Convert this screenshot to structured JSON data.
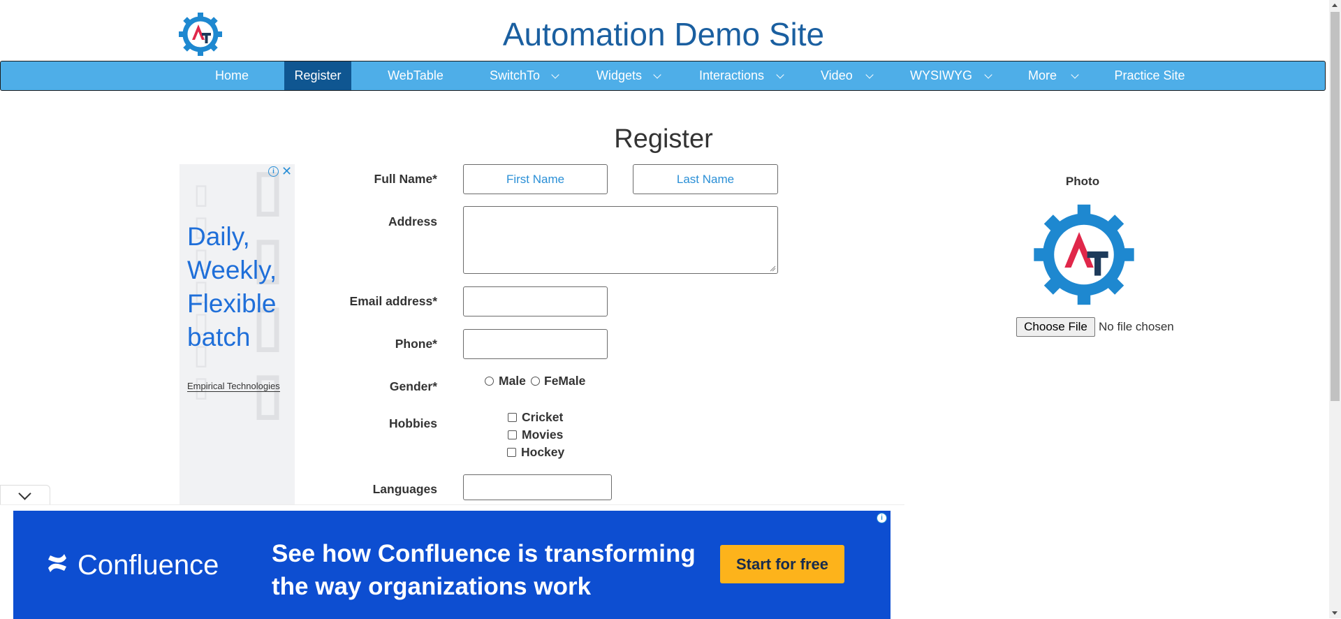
{
  "site": {
    "title": "Automation Demo Site"
  },
  "nav": {
    "items": [
      {
        "label": "Home"
      },
      {
        "label": "Register"
      },
      {
        "label": "WebTable"
      },
      {
        "label": "SwitchTo"
      },
      {
        "label": "Widgets"
      },
      {
        "label": "Interactions"
      },
      {
        "label": "Video"
      },
      {
        "label": "WYSIWYG"
      },
      {
        "label": "More"
      },
      {
        "label": "Practice Site"
      }
    ],
    "active": "Register"
  },
  "form": {
    "title": "Register",
    "full_name_label": "Full Name*",
    "first_name_placeholder": "First Name",
    "last_name_placeholder": "Last Name",
    "address_label": "Address",
    "email_label": "Email address*",
    "phone_label": "Phone*",
    "gender_label": "Gender*",
    "gender_options": [
      "Male",
      "FeMale"
    ],
    "hobbies_label": "Hobbies",
    "hobbies": [
      "Cricket",
      "Movies",
      "Hockey"
    ],
    "languages_label": "Languages"
  },
  "photo": {
    "label": "Photo",
    "button": "Choose File",
    "status": "No file chosen"
  },
  "side_ad": {
    "text": "Daily, Weekly, Flexible batch",
    "brand": "Empirical Technologies"
  },
  "bottom_ad": {
    "brand": "Confluence",
    "headline_line1": "See how Confluence is transforming",
    "headline_line2": "the way organizations work",
    "cta": "Start for free"
  },
  "colors": {
    "title_blue": "#1a5fa0",
    "nav_bg": "#4eaee8",
    "nav_active": "#0f5691",
    "ad_blue": "#0d4ed1",
    "cta_yellow": "#fdb31b"
  }
}
